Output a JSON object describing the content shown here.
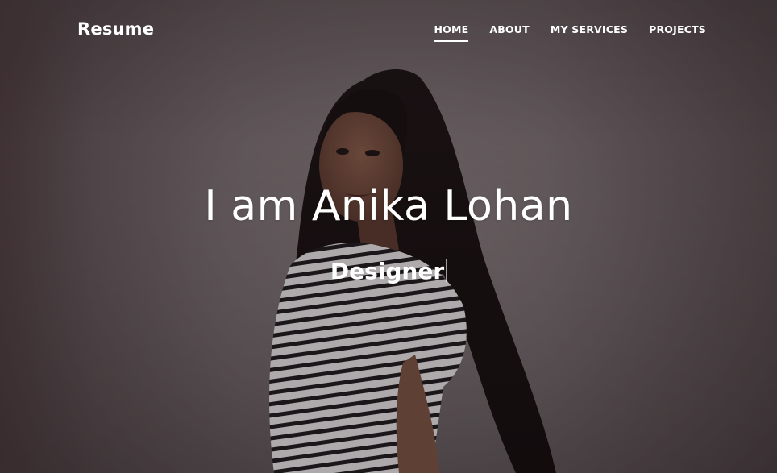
{
  "header": {
    "brand": "Resume",
    "nav": [
      {
        "label": "HOME",
        "active": true
      },
      {
        "label": "ABOUT",
        "active": false
      },
      {
        "label": "MY SERVICES",
        "active": false
      },
      {
        "label": "PROJECTS",
        "active": false
      }
    ]
  },
  "hero": {
    "title": "I am Anika Lohan",
    "subtitle": "Designer",
    "background_image": "portrait-photo"
  },
  "colors": {
    "text": "#ffffff",
    "overlay": "#3c3235"
  }
}
